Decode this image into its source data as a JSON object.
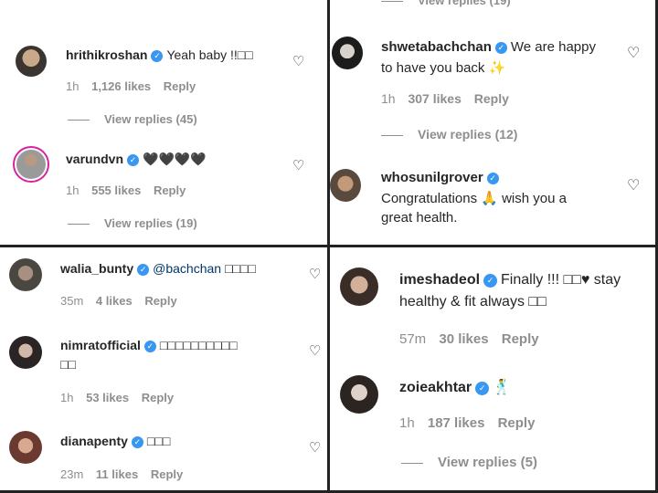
{
  "panels": [
    {
      "top_reply": "",
      "comments": [
        {
          "username": "hrithikroshan",
          "text": "Yeah baby !!□□",
          "time": "1h",
          "likes": "1,126 likes",
          "reply": "Reply",
          "view_replies": "View replies (45)"
        },
        {
          "username": "varundvn",
          "text": "🖤🖤🖤🖤",
          "time": "1h",
          "likes": "555 likes",
          "reply": "Reply",
          "view_replies": "View replies (19)"
        }
      ]
    },
    {
      "top_reply": "View replies (19)",
      "comments": [
        {
          "username": "shwetabachchan",
          "text": "We are happy",
          "text2": "to have you back ✨",
          "time": "1h",
          "likes": "307 likes",
          "reply": "Reply",
          "view_replies": "View replies (12)"
        },
        {
          "username": "whosunilgrover",
          "text": "Congratulations 🙏 wish you a",
          "text2": "great health.",
          "time": "",
          "likes": "",
          "reply": "",
          "view_replies": ""
        }
      ]
    },
    {
      "comments": [
        {
          "username": "walia_bunty",
          "mention": "@bachchan",
          "text": "□□□□",
          "time": "35m",
          "likes": "4 likes",
          "reply": "Reply"
        },
        {
          "username": "nimratofficial",
          "text": "□□□□□□□□□□",
          "text2": "□□",
          "time": "1h",
          "likes": "53 likes",
          "reply": "Reply"
        },
        {
          "username": "dianapenty",
          "text": "□□□",
          "time": "23m",
          "likes": "11 likes",
          "reply": "Reply"
        }
      ]
    },
    {
      "comments": [
        {
          "username": "imeshadeol",
          "text": "Finally !!! □□♥ stay",
          "text2": "healthy & fit always □□",
          "time": "57m",
          "likes": "30 likes",
          "reply": "Reply"
        },
        {
          "username": "zoieakhtar",
          "text": "🕺",
          "time": "1h",
          "likes": "187 likes",
          "reply": "Reply",
          "view_replies": "View replies (5)"
        }
      ]
    }
  ],
  "icons": {
    "verified": "verified-badge-icon",
    "heart": "heart-outline-icon"
  },
  "colors": {
    "verified": "#3897f0",
    "muted": "#8e8e8e",
    "text": "#262626"
  }
}
